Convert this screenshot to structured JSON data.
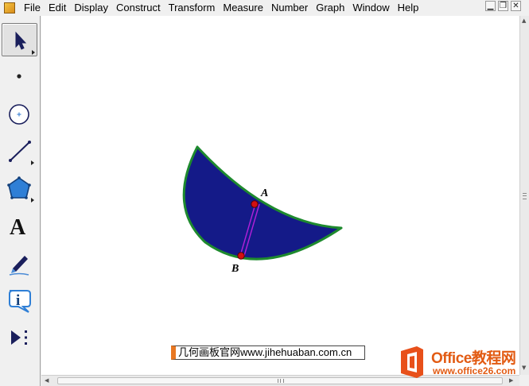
{
  "menu": {
    "items": [
      "File",
      "Edit",
      "Display",
      "Construct",
      "Transform",
      "Measure",
      "Number",
      "Graph",
      "Window",
      "Help"
    ]
  },
  "window_controls": {
    "minimize_icon": "minimize-icon",
    "restore_icon": "restore-icon",
    "close_icon": "close-icon"
  },
  "toolbox": {
    "tools": [
      {
        "name": "arrow-tool",
        "icon": "arrow-select-icon",
        "selected": true
      },
      {
        "name": "point-tool",
        "icon": "point-icon"
      },
      {
        "name": "compass-tool",
        "icon": "circle-compass-icon"
      },
      {
        "name": "straightedge-tool",
        "icon": "line-segment-icon"
      },
      {
        "name": "polygon-tool",
        "icon": "pentagon-icon"
      },
      {
        "name": "text-tool",
        "icon": "text-a-icon",
        "glyph": "A"
      },
      {
        "name": "marker-tool",
        "icon": "marker-pen-icon"
      },
      {
        "name": "information-tool",
        "icon": "info-icon",
        "glyph": "i"
      },
      {
        "name": "custom-tool",
        "icon": "custom-tool-icon"
      }
    ]
  },
  "sketch": {
    "point_a_label": "A",
    "point_b_label": "B",
    "colors": {
      "shape_fill": "#141a88",
      "shape_stroke": "#1e8a2e",
      "segment": "#b020d8",
      "point_fill": "#d41010"
    }
  },
  "watermarks": {
    "site_text": "几何画板官网www.jihehuaban.com.cn",
    "brand_name": "Office教程网",
    "brand_url": "www.office26.com",
    "brand_color": "#e25b13"
  }
}
